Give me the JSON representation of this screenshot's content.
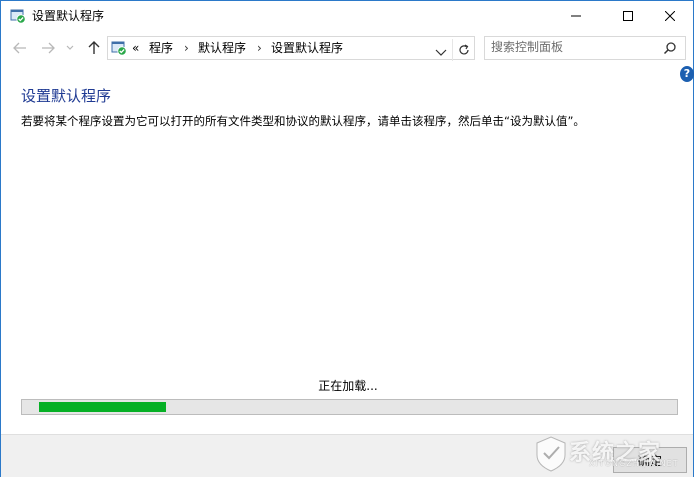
{
  "window": {
    "title": "设置默认程序"
  },
  "titlebar": {
    "minimize_icon": "minimize-icon",
    "maximize_icon": "maximize-icon",
    "close_icon": "close-icon"
  },
  "nav": {
    "back_icon": "arrow-left-icon",
    "forward_icon": "arrow-right-icon",
    "recent_icon": "chevron-down-icon",
    "up_icon": "arrow-up-icon",
    "breadcrumbs": {
      "overflow": "«",
      "item1": "程序",
      "item2": "默认程序",
      "item3": "设置默认程序"
    },
    "separator": "›",
    "search_placeholder": "搜索控制面板"
  },
  "main": {
    "heading": "设置默认程序",
    "description": "若要将某个程序设置为它可以打开的所有文件类型和协议的默认程序，请单击该程序，然后单击“设为默认值”。",
    "loading_text": "正在加载...",
    "progress_fraction": 0.195
  },
  "help": {
    "label": "?"
  },
  "footer": {
    "ok_label": "确定"
  },
  "watermark": {
    "text": "系统之家",
    "sub": "XITONGZHIJIA.NET"
  },
  "colors": {
    "accent": "#1c5fb0",
    "progress": "#06b025",
    "heading": "#1f3a93",
    "border": "#2b79c9"
  }
}
